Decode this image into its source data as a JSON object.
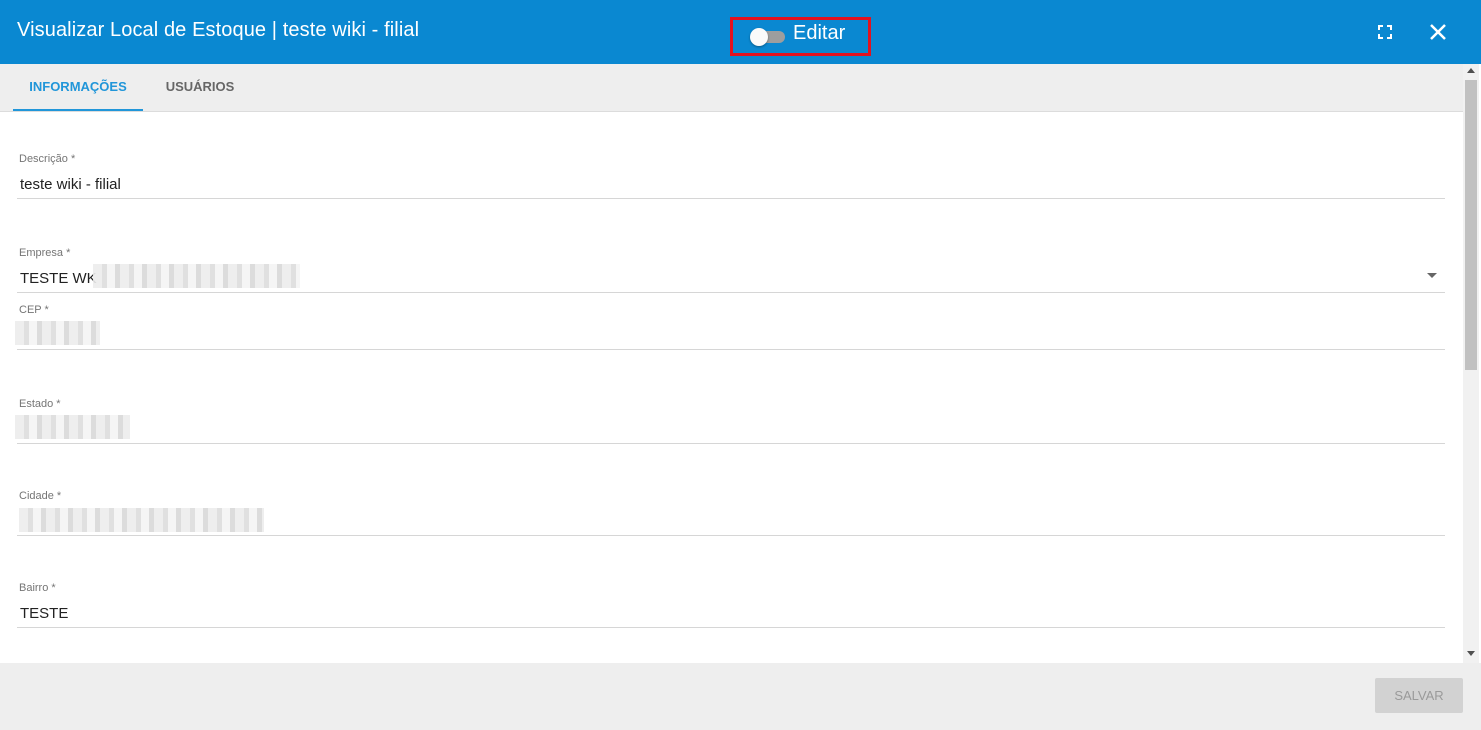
{
  "dialog": {
    "title": "Visualizar Local de Estoque | teste wiki - filial",
    "edit_toggle_label": "Editar",
    "edit_toggle_on": false
  },
  "icons": {
    "fullscreen": "fullscreen-icon",
    "close": "close-icon",
    "dropdown": "chevron-down-icon"
  },
  "tabs": [
    {
      "label": "INFORMAÇÕES",
      "active": true
    },
    {
      "label": "USUÁRIOS",
      "active": false
    }
  ],
  "form": {
    "descricao": {
      "label": "Descrição *",
      "value": "teste wiki - filial"
    },
    "empresa": {
      "label": "Empresa *",
      "value": "TESTE WK"
    },
    "cep": {
      "label": "CEP *",
      "value": ""
    },
    "estado": {
      "label": "Estado *",
      "value": ""
    },
    "cidade": {
      "label": "Cidade *",
      "value": ""
    },
    "bairro": {
      "label": "Bairro *",
      "value": "TESTE"
    }
  },
  "footer": {
    "save_label": "SALVAR"
  },
  "colors": {
    "header": "#0a88d1",
    "accent": "#2196d9",
    "highlight_box": "#e3121f"
  }
}
